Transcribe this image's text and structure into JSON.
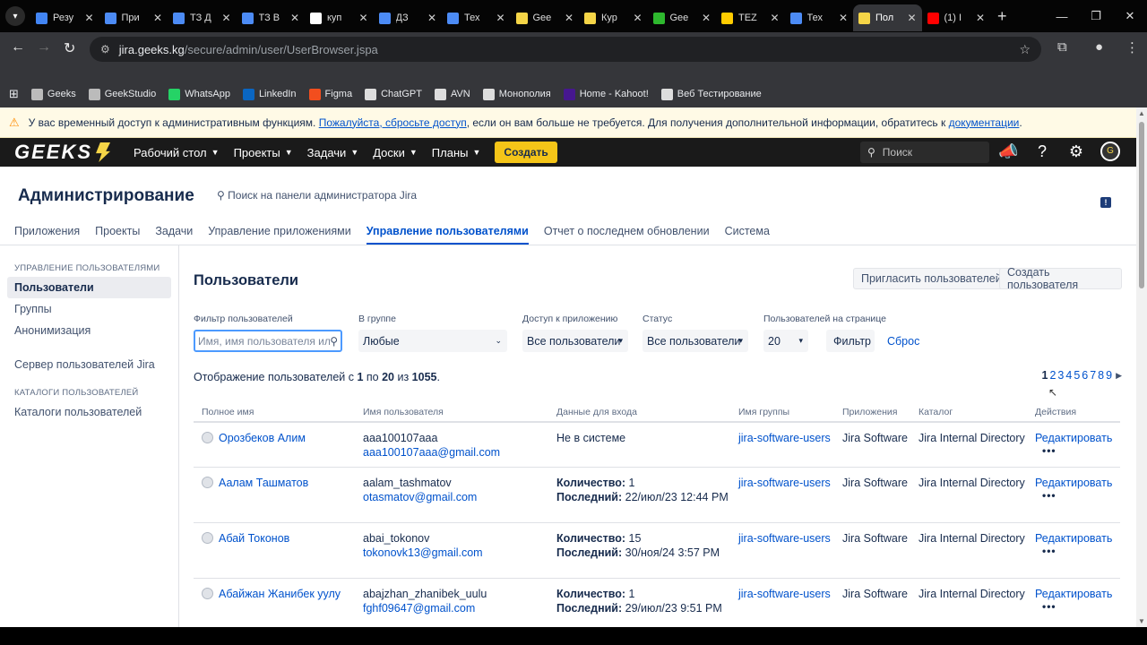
{
  "browser": {
    "tabs": [
      {
        "title": "Резу",
        "color": "#4285f4"
      },
      {
        "title": "При",
        "color": "#4c8bf5"
      },
      {
        "title": "ТЗ Д",
        "color": "#4c8bf5"
      },
      {
        "title": "ТЗ В",
        "color": "#4c8bf5"
      },
      {
        "title": "куп",
        "color": "#ffffff"
      },
      {
        "title": "ДЗ",
        "color": "#4c8bf5"
      },
      {
        "title": "Тех",
        "color": "#4c8bf5"
      },
      {
        "title": "Gee",
        "color": "#f5d547"
      },
      {
        "title": "Кур",
        "color": "#f5d547"
      },
      {
        "title": "Gee",
        "color": "#2eb82e"
      },
      {
        "title": "TEZ",
        "color": "#ffcc00"
      },
      {
        "title": "Тех",
        "color": "#4c8bf5"
      },
      {
        "title": "Пол",
        "color": "#f5d547",
        "active": true
      },
      {
        "title": "(1) I",
        "color": "#ff0000"
      }
    ],
    "url_host": "jira.geeks.kg",
    "url_path": "/secure/admin/user/UserBrowser.jspa",
    "bookmarks": [
      {
        "label": "Geeks",
        "color": "#bbbbbb"
      },
      {
        "label": "GeekStudio",
        "color": "#bbbbbb"
      },
      {
        "label": "WhatsApp",
        "color": "#25d366"
      },
      {
        "label": "LinkedIn",
        "color": "#0a66c2"
      },
      {
        "label": "Figma",
        "color": "#f24e1e"
      },
      {
        "label": "ChatGPT",
        "color": "#dddddd"
      },
      {
        "label": "AVN",
        "color": "#dddddd"
      },
      {
        "label": "Монополия",
        "color": "#dddddd"
      },
      {
        "label": "Home - Kahoot!",
        "color": "#46178f"
      },
      {
        "label": "Веб Тестирование",
        "color": "#dddddd"
      }
    ]
  },
  "warning": {
    "text_before": "У вас временный доступ к административным функциям. ",
    "link1": "Пожалуйста, сбросьте доступ",
    "text_middle": ", если он вам больше не требуется. Для получения дополнительной информации, обратитесь к ",
    "link2": "документации",
    "text_end": "."
  },
  "jira_nav": {
    "logo": "GEEKS",
    "menu": [
      "Рабочий стол",
      "Проекты",
      "Задачи",
      "Доски",
      "Планы"
    ],
    "create": "Создать",
    "search_placeholder": "Поиск"
  },
  "admin": {
    "title": "Администрирование",
    "search": "Поиск на панели администратора Jira",
    "tabs": [
      "Приложения",
      "Проекты",
      "Задачи",
      "Управление приложениями",
      "Управление пользователями",
      "Отчет о последнем обновлении",
      "Система"
    ]
  },
  "sidebar": {
    "section1": "УПРАВЛЕНИЕ ПОЛЬЗОВАТЕЛЯМИ",
    "items1": [
      "Пользователи",
      "Группы",
      "Анонимизация"
    ],
    "item_server": "Сервер пользователей Jira",
    "section2": "КАТАЛОГИ ПОЛЬЗОВАТЕЛЕЙ",
    "items2": [
      "Каталоги пользователей"
    ]
  },
  "users": {
    "title": "Пользователи",
    "invite": "Пригласить пользователей",
    "create": "Создать пользователя",
    "filters": {
      "user_label": "Фильтр пользователей",
      "user_placeholder": "Имя, имя пользователя или",
      "group_label": "В группе",
      "group_value": "Любые",
      "access_label": "Доступ к приложению",
      "access_value": "Все пользователи",
      "status_label": "Статус",
      "status_value": "Все пользователи",
      "per_page_label": "Пользователей на странице",
      "per_page_value": "20",
      "filter_btn": "Фильтр",
      "reset": "Сброс"
    },
    "showing": {
      "prefix": "Отображение пользователей с ",
      "from": "1",
      "mid1": " по ",
      "to": "20",
      "mid2": " из ",
      "total": "1055",
      "suffix": "."
    },
    "pages": [
      "1",
      "2",
      "3",
      "4",
      "5",
      "6",
      "7",
      "8",
      "9"
    ],
    "columns": [
      "Полное имя",
      "Имя пользователя",
      "Данные для входа",
      "Имя группы",
      "Приложения",
      "Каталог",
      "Действия"
    ],
    "rows": [
      {
        "full_name": "Орозбеков Алим",
        "username": "aaa100107aaa",
        "email": "aaa100107aaa@gmail.com",
        "login": "Не в системе",
        "count_label": "",
        "count": "",
        "last_label": "",
        "last": "",
        "group": "jira-software-users",
        "app": "Jira Software",
        "directory": "Jira Internal Directory",
        "action": "Редактировать"
      },
      {
        "full_name": "Аалам Ташматов",
        "username": "aalam_tashmatov",
        "email": "otasmatov@gmail.com",
        "login": "",
        "count_label": "Количество:",
        "count": " 1",
        "last_label": "Последний:",
        "last": " 22/июл/23 12:44 PM",
        "group": "jira-software-users",
        "app": "Jira Software",
        "directory": "Jira Internal Directory",
        "action": "Редактировать"
      },
      {
        "full_name": "Абай Токонов",
        "username": "abai_tokonov",
        "email": "tokonovk13@gmail.com",
        "login": "",
        "count_label": "Количество:",
        "count": " 15",
        "last_label": "Последний:",
        "last": " 30/ноя/24 3:57 PM",
        "group": "jira-software-users",
        "app": "Jira Software",
        "directory": "Jira Internal Directory",
        "action": "Редактировать"
      },
      {
        "full_name": "Абайжан Жанибек уулу",
        "username": "abajzhan_zhanibek_uulu",
        "email": "fghf09647@gmail.com",
        "login": "",
        "count_label": "Количество:",
        "count": " 1",
        "last_label": "Последний:",
        "last": " 29/июл/23 9:51 PM",
        "group": "jira-software-users",
        "app": "Jira Software",
        "directory": "Jira Internal Directory",
        "action": "Редактировать"
      }
    ]
  }
}
